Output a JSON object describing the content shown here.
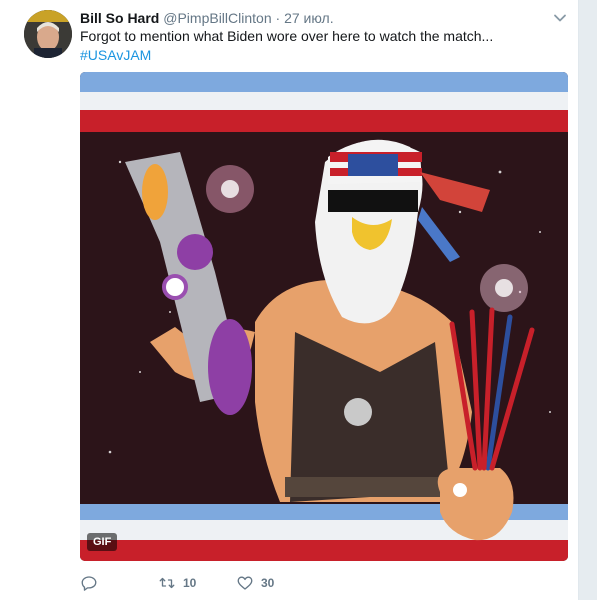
{
  "tweet": {
    "display_name": "Bill So Hard",
    "handle": "@PimpBillClinton",
    "separator": "·",
    "date": "27 июл.",
    "text": "Forgot to mention what Biden wore over here to watch the match...",
    "hashtag": "#USAvJAM",
    "media": {
      "badge": "GIF",
      "description": "Illustration of a bald-eagle-headed muscleman in an American flag headband with a water gun and fireworks"
    },
    "actions": {
      "reply_icon": "reply-icon",
      "retweet_icon": "retweet-icon",
      "retweet_count": "10",
      "like_icon": "heart-icon",
      "like_count": "30"
    }
  },
  "colors": {
    "link": "#1b95e0",
    "name": "#14171a",
    "secondary": "#657786",
    "background": "#e6ecf0"
  }
}
